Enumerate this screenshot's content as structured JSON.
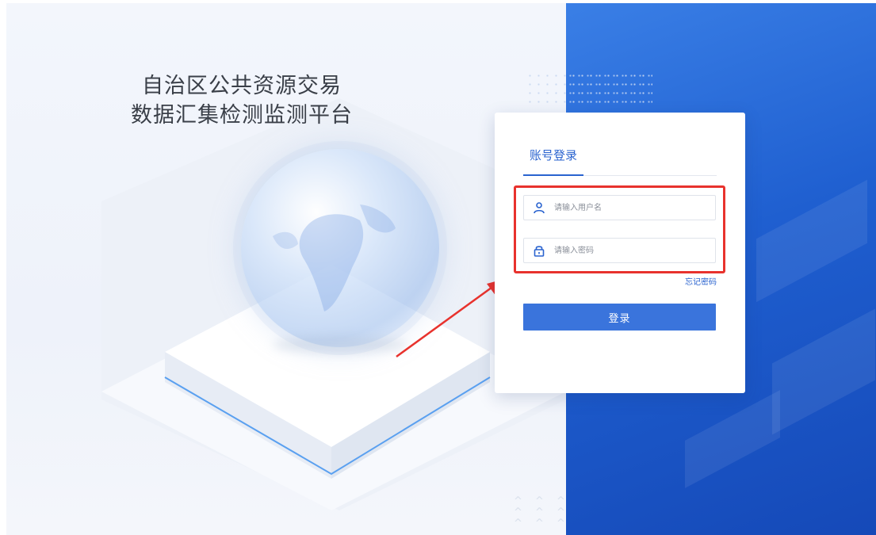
{
  "header": {
    "title_line1": "自治区公共资源交易",
    "title_line2": "数据汇集检测监测平台"
  },
  "login": {
    "tab_label": "账号登录",
    "username_placeholder": "请输入用户名",
    "password_placeholder": "请输入密码",
    "forgot_label": "忘记密码",
    "submit_label": "登录"
  },
  "decor": {
    "chevrons": "^ ^ ^\n^ ^ ^\n^ ^ ^"
  },
  "colors": {
    "accent": "#2a63cf",
    "button": "#3a74dc",
    "highlight": "#e8322d",
    "panel_blue": "#1f5fd0"
  },
  "icons": {
    "username": "user-icon",
    "password": "lock-icon",
    "annotation": "red-arrow"
  }
}
